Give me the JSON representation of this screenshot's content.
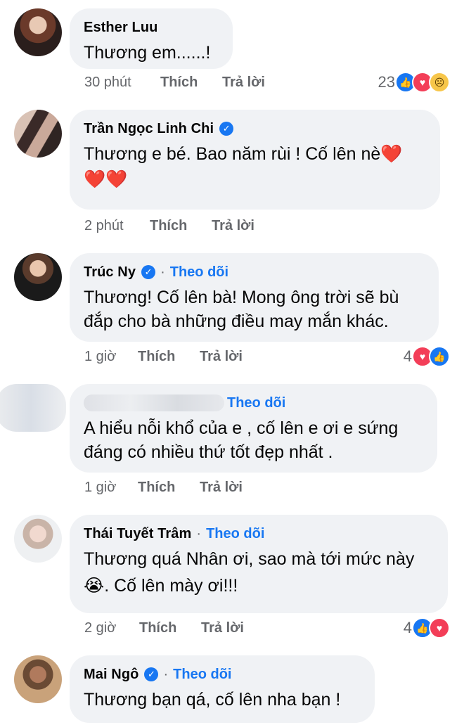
{
  "comments": [
    {
      "name": "Esther Luu",
      "verified": false,
      "follow": "",
      "text": [
        "Thương em......!"
      ],
      "time": "30 phút",
      "like": "Thích",
      "reply": "Trả lời",
      "reactions_count": "23",
      "reactions": [
        "like",
        "love",
        "sad"
      ]
    },
    {
      "name": "Trần Ngọc Linh Chi",
      "verified": true,
      "follow": "",
      "text": [
        "Thương e bé. Bao năm rùi ! Cố lên nè❤️",
        "❤️❤️"
      ],
      "time": "2 phút",
      "like": "Thích",
      "reply": "Trả lời",
      "reactions_count": "",
      "reactions": []
    },
    {
      "name": "Trúc Ny",
      "verified": true,
      "follow": "Theo dõi",
      "text": [
        "Thương! Cố lên bà! Mong ông trời sẽ bù",
        "đắp cho bà những điều may mắn khác."
      ],
      "time": "1 giờ",
      "like": "Thích",
      "reply": "Trả lời",
      "reactions_count": "4",
      "reactions": [
        "love",
        "like"
      ]
    },
    {
      "name": "",
      "verified": false,
      "follow": "Theo dõi",
      "text": [
        "A hiểu nỗi khổ của e , cố lên e ơi e sứng",
        "đáng có nhiều thứ tốt đẹp nhất ."
      ],
      "time": "1 giờ",
      "like": "Thích",
      "reply": "Trả lời",
      "reactions_count": "",
      "reactions": []
    },
    {
      "name": "Thái Tuyết Trâm",
      "verified": false,
      "follow": "Theo dõi",
      "text": [
        "Thương quá Nhân ơi, sao mà tới mức này",
        "😭. Cố lên mày ơi!!!"
      ],
      "time": "2 giờ",
      "like": "Thích",
      "reply": "Trả lời",
      "reactions_count": "4",
      "reactions": [
        "like",
        "love"
      ]
    },
    {
      "name": "Mai Ngô",
      "verified": true,
      "follow": "Theo dõi",
      "text": [
        "Thương bạn qá, cố lên nha bạn !"
      ],
      "time": "",
      "like": "",
      "reply": "",
      "reactions_count": "",
      "reactions": []
    }
  ],
  "colors": {
    "accent": "#1877f2",
    "bubble": "#f0f2f5",
    "muted": "#65676b",
    "love": "#f33e58"
  }
}
